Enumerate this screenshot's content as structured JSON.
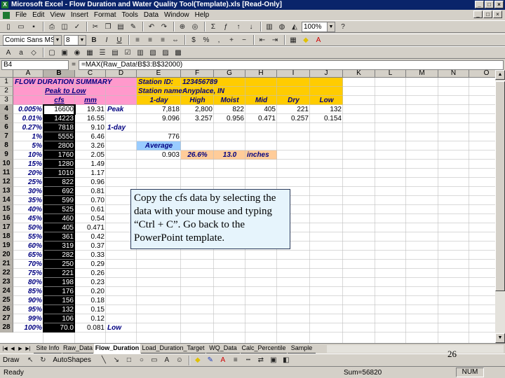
{
  "window": {
    "title": "Microsoft Excel - Flow Duration and Water Quality Tool(Template).xls [Read-Only]",
    "minimize": "_",
    "restore": "□",
    "close": "×"
  },
  "menu": [
    "File",
    "Edit",
    "View",
    "Insert",
    "Format",
    "Tools",
    "Data",
    "Window",
    "Help"
  ],
  "toolbar": {
    "zoom": "100%",
    "font": "Comic Sans MS",
    "font_size": "8"
  },
  "formula_bar": {
    "name_box": "B4",
    "eq": "=",
    "formula": "=MAX(Raw_Data!B$3:B$32000)"
  },
  "columns": [
    "A",
    "B",
    "C",
    "D",
    "E",
    "F",
    "G",
    "H",
    "I",
    "J",
    "K",
    "L",
    "M",
    "N",
    "O"
  ],
  "rows": [
    "1",
    "2",
    "3",
    "4",
    "5",
    "6",
    "7",
    "8",
    "9",
    "10",
    "11",
    "12",
    "13",
    "14",
    "15",
    "16",
    "17",
    "18",
    "19",
    "20",
    "21",
    "22",
    "23",
    "24",
    "25",
    "26",
    "27",
    "28"
  ],
  "colors": {
    "pink": "#ff99cc",
    "gold": "#ffcc00",
    "light_blue": "#99ccff",
    "peach": "#ffcc99",
    "selection_black": "#000000"
  },
  "sheet": {
    "header_title": "FLOW DURATION SUMMARY",
    "peak_to_low": "Peak to Low",
    "col_cfs": "cfs",
    "col_mm": "mm",
    "station_id_label": "Station ID:",
    "station_id": "123456789",
    "station_name_label": "Station name:",
    "station_name": "Anyplace, IN",
    "headers": [
      "1-day",
      "High",
      "Moist",
      "Mid",
      "Dry",
      "Low"
    ],
    "row4_vals": [
      "7,818",
      "2,800",
      "822",
      "405",
      "221",
      "132"
    ],
    "row5_vals": [
      "9.096",
      "3.257",
      "0.956",
      "0.471",
      "0.257",
      "0.154"
    ],
    "peak": "Peak",
    "one_day": "1-day",
    "low": "Low",
    "average": "Average",
    "avg1": "776",
    "avg2": "0.903",
    "pct": "26.6%",
    "inches_val": "13.0",
    "inches": "inches",
    "percentiles": [
      "0.005%",
      "0.01%",
      "0.27%",
      "1%",
      "5%",
      "10%",
      "15%",
      "20%",
      "25%",
      "30%",
      "35%",
      "40%",
      "45%",
      "50%",
      "55%",
      "60%",
      "65%",
      "70%",
      "75%",
      "80%",
      "85%",
      "90%",
      "95%",
      "99%",
      "100%"
    ],
    "cfs": [
      "16600",
      "14223",
      "7818",
      "5555",
      "2800",
      "1760",
      "1280",
      "1010",
      "822",
      "692",
      "599",
      "525",
      "460",
      "405",
      "361",
      "319",
      "282",
      "250",
      "221",
      "198",
      "176",
      "156",
      "132",
      "106",
      "70.0"
    ],
    "mm": [
      "19.31",
      "16.55",
      "9.10",
      "6.46",
      "3.26",
      "2.05",
      "1.49",
      "1.17",
      "0.96",
      "0.81",
      "0.70",
      "0.61",
      "0.54",
      "0.471",
      "0.42",
      "0.37",
      "0.33",
      "0.29",
      "0.26",
      "0.23",
      "0.20",
      "0.18",
      "0.15",
      "0.12",
      "0.081"
    ]
  },
  "tabs": [
    "Site Info",
    "Raw_Data",
    "Flow_Duration",
    "Load_Duration_Target",
    "WQ_Data",
    "Calc_Percentile",
    "Sample"
  ],
  "draw_bar": {
    "draw": "Draw",
    "autoshapes": "AutoShapes"
  },
  "status": {
    "ready": "Ready",
    "sum": "Sum=56820",
    "num": "NUM"
  },
  "callout": "Copy the cfs data by selecting the data with your mouse and typing “Ctrl + C”.  Go back to the PowerPoint template.",
  "slide_number": "26"
}
